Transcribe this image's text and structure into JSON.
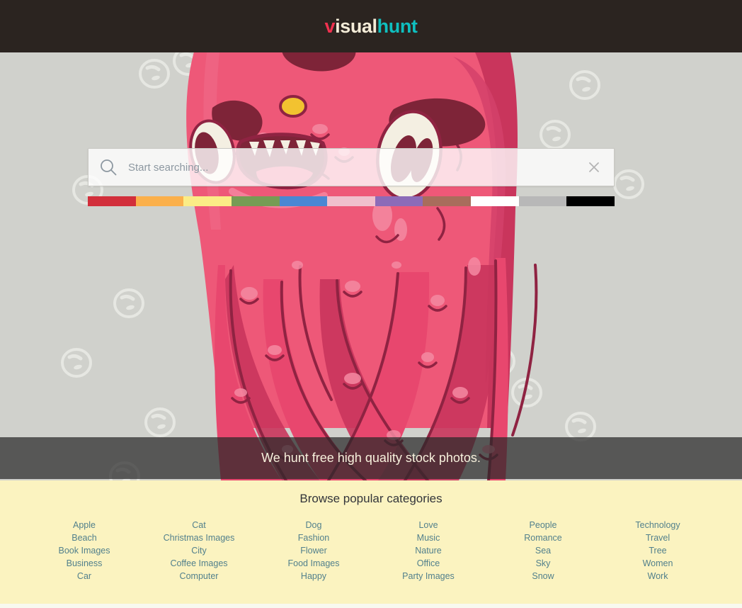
{
  "header": {
    "logo": {
      "part1": "v",
      "part2": "isual",
      "part3": "hunt"
    },
    "background": "#2b2420",
    "colors": {
      "v": "#f0314f",
      "isual": "#f4ecd8",
      "hunt": "#0fbfbf"
    }
  },
  "hero": {
    "background": "#d0d1cc",
    "illustration": "pink-monster-mascot",
    "search": {
      "placeholder": "Start searching...",
      "value": "",
      "icon": "search-icon",
      "clear_icon": "close-icon"
    },
    "swatches": [
      {
        "name": "red",
        "hex": "#d22f3b"
      },
      {
        "name": "orange",
        "hex": "#fbb04b"
      },
      {
        "name": "yellow",
        "hex": "#fbec86"
      },
      {
        "name": "green",
        "hex": "#769c54"
      },
      {
        "name": "blue",
        "hex": "#4a87d3"
      },
      {
        "name": "pink",
        "hex": "#f0bfcd"
      },
      {
        "name": "purple",
        "hex": "#8c6bb8"
      },
      {
        "name": "brown",
        "hex": "#a86d5c"
      },
      {
        "name": "white",
        "hex": "#ffffff"
      },
      {
        "name": "gray",
        "hex": "#b8b8b8"
      },
      {
        "name": "black",
        "hex": "#000000"
      }
    ],
    "tagline": "We hunt free high quality stock photos."
  },
  "categories": {
    "title": "Browse popular categories",
    "background": "#fbf3c0",
    "link_color": "#52808c",
    "columns": [
      {
        "items": [
          "Apple",
          "Beach",
          "Book Images",
          "Business",
          "Car"
        ]
      },
      {
        "items": [
          "Cat",
          "Christmas Images",
          "City",
          "Coffee Images",
          "Computer"
        ]
      },
      {
        "items": [
          "Dog",
          "Fashion",
          "Flower",
          "Food Images",
          "Happy"
        ]
      },
      {
        "items": [
          "Love",
          "Music",
          "Nature",
          "Office",
          "Party Images"
        ]
      },
      {
        "items": [
          "People",
          "Romance",
          "Sea",
          "Sky",
          "Snow"
        ]
      },
      {
        "items": [
          "Technology",
          "Travel",
          "Tree",
          "Women",
          "Work"
        ]
      }
    ]
  }
}
